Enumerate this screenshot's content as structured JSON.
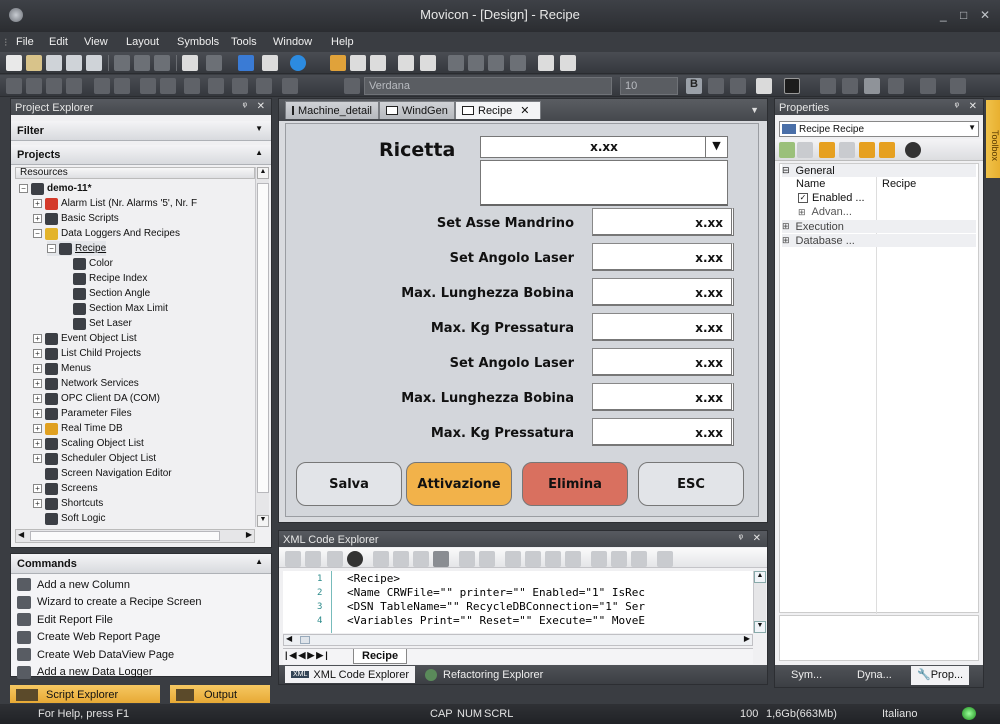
{
  "window": {
    "title": "Movicon - [Design] - Recipe",
    "minimize": "_",
    "maximize": "□",
    "close": "✕"
  },
  "menu": [
    "File",
    "Edit",
    "View",
    "Layout",
    "Symbols",
    "Tools",
    "Window",
    "Help"
  ],
  "toolbar": {
    "font_name": "Verdana",
    "font_size": "10"
  },
  "project_explorer": {
    "title": "Project Explorer",
    "pin": "ᵠ",
    "close": "✕",
    "filter": "Filter",
    "projects": "Projects",
    "resources": "Resources",
    "tree": [
      {
        "label": "demo-11*",
        "bold": true,
        "level": 0,
        "pm": "−"
      },
      {
        "label": "Alarm List (Nr. Alarms '5', Nr. F",
        "level": 1,
        "pm": "+"
      },
      {
        "label": "Basic Scripts",
        "level": 1,
        "pm": "+"
      },
      {
        "label": "Data Loggers And Recipes",
        "level": 1,
        "pm": "−"
      },
      {
        "label": "Recipe",
        "level": 2,
        "pm": "−",
        "underline": true
      },
      {
        "label": "Color",
        "level": 3,
        "pm": ""
      },
      {
        "label": "Recipe Index",
        "level": 3,
        "pm": ""
      },
      {
        "label": "Section Angle",
        "level": 3,
        "pm": ""
      },
      {
        "label": "Section Max Limit",
        "level": 3,
        "pm": ""
      },
      {
        "label": "Set Laser",
        "level": 3,
        "pm": ""
      },
      {
        "label": "Event Object List",
        "level": 1,
        "pm": "+"
      },
      {
        "label": "List Child Projects",
        "level": 1,
        "pm": "+"
      },
      {
        "label": "Menus",
        "level": 1,
        "pm": "+"
      },
      {
        "label": "Network Services",
        "level": 1,
        "pm": "+"
      },
      {
        "label": "OPC Client DA (COM)",
        "level": 1,
        "pm": "+"
      },
      {
        "label": "Parameter Files",
        "level": 1,
        "pm": "+"
      },
      {
        "label": "Real Time DB",
        "level": 1,
        "pm": "+"
      },
      {
        "label": "Scaling Object List",
        "level": 1,
        "pm": "+"
      },
      {
        "label": "Scheduler Object List",
        "level": 1,
        "pm": "+"
      },
      {
        "label": "Screen Navigation Editor",
        "level": 1,
        "pm": ""
      },
      {
        "label": "Screens",
        "level": 1,
        "pm": "+"
      },
      {
        "label": "Shortcuts",
        "level": 1,
        "pm": "+"
      },
      {
        "label": "Soft Logic",
        "level": 1,
        "pm": ""
      }
    ]
  },
  "commands": {
    "title": "Commands",
    "items": [
      "Add a new Column",
      "Wizard to create a Recipe Screen",
      "Edit Report File",
      "Create Web Report Page",
      "Create Web DataView Page",
      "Add a new Data Logger"
    ]
  },
  "bottom_tabs": {
    "script_explorer": "Script Explorer",
    "output": "Output"
  },
  "doc_tabs": [
    "Machine_detail",
    "WindGen",
    "Recipe"
  ],
  "recipe_form": {
    "title": "Ricetta",
    "combo_value": "x.xx",
    "fields": [
      {
        "label": "Set Asse Mandrino",
        "value": "x.xx"
      },
      {
        "label": "Set Angolo Laser",
        "value": "x.xx"
      },
      {
        "label": "Max. Lunghezza Bobina",
        "value": "x.xx"
      },
      {
        "label": "Max. Kg Pressatura",
        "value": "x.xx"
      },
      {
        "label": "Set Angolo Laser",
        "value": "x.xx"
      },
      {
        "label": "Max. Lunghezza Bobina",
        "value": "x.xx"
      },
      {
        "label": "Max. Kg Pressatura",
        "value": "x.xx"
      }
    ],
    "buttons": [
      {
        "label": "Salva",
        "color": "#e2e4e8"
      },
      {
        "label": "Attivazione",
        "color": "#f2b24a"
      },
      {
        "label": "Elimina",
        "color": "#d9705f"
      },
      {
        "label": "ESC",
        "color": "#e2e4e8"
      }
    ]
  },
  "xml_explorer": {
    "title": "XML Code Explorer",
    "lines": [
      {
        "n": "1",
        "text": "<Recipe>"
      },
      {
        "n": "2",
        "text": "<Name CRWFile=\"\" printer=\"\" Enabled=\"1\" IsRec"
      },
      {
        "n": "3",
        "text": "<DSN TableName=\"\" RecycleDBConnection=\"1\" Ser"
      },
      {
        "n": "4",
        "text": "<Variables Print=\"\" Reset=\"\" Execute=\"\" MoveE"
      }
    ],
    "sheet_tab": "Recipe",
    "tabs": [
      "XML Code Explorer",
      "Refactoring Explorer"
    ]
  },
  "properties": {
    "title": "Properties",
    "object": "Recipe Recipe",
    "general": "General",
    "name_label": "Name",
    "name_value": "Recipe",
    "enabled": "Enabled ...",
    "advanced": "Advan...",
    "execution": "Execution",
    "database": "Database ...",
    "tabs": [
      "Sym...",
      "Dyna...",
      "Prop..."
    ]
  },
  "toolbox": "Toolbox",
  "status": {
    "help": "For Help, press F1",
    "cap": "CAP",
    "num": "NUM",
    "scrl": "SCRL",
    "zoom": "100",
    "memory": "1,6Gb(663Mb)",
    "language": "Italiano"
  }
}
